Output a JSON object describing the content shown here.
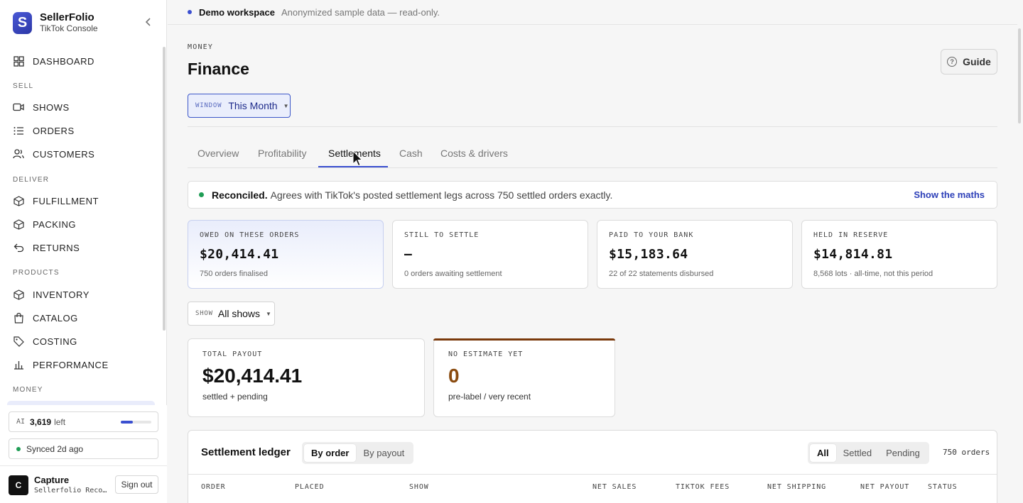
{
  "brand": {
    "name": "SellerFolio",
    "sub": "TikTok Console",
    "logo_letter": "S"
  },
  "sidebar": {
    "sections": {
      "sell": "SELL",
      "deliver": "DELIVER",
      "products": "PRODUCTS",
      "money": "MONEY"
    },
    "items": [
      {
        "label": "DASHBOARD",
        "icon": "grid-icon"
      },
      {
        "label": "SHOWS",
        "icon": "video-icon"
      },
      {
        "label": "ORDERS",
        "icon": "list-icon"
      },
      {
        "label": "CUSTOMERS",
        "icon": "users-icon"
      },
      {
        "label": "FULFILLMENT",
        "icon": "box-icon"
      },
      {
        "label": "PACKING",
        "icon": "box-icon"
      },
      {
        "label": "RETURNS",
        "icon": "return-arrow-icon"
      },
      {
        "label": "INVENTORY",
        "icon": "box-icon"
      },
      {
        "label": "CATALOG",
        "icon": "shopping-bag-icon"
      },
      {
        "label": "COSTING",
        "icon": "tag-icon"
      },
      {
        "label": "PERFORMANCE",
        "icon": "bar-chart-icon"
      }
    ],
    "ai": {
      "tag": "AI",
      "count": "3,619",
      "left": "left",
      "usage_fraction": 0.4
    },
    "sync": "Synced 2d ago",
    "user": {
      "initial": "C",
      "name": "Capture",
      "sub": "Sellerfolio Recording",
      "signout": "Sign out"
    }
  },
  "topbar": {
    "title": "Demo workspace",
    "note": "Anonymized sample data — read-only."
  },
  "header": {
    "eyebrow": "MONEY",
    "title": "Finance",
    "guide": "Guide"
  },
  "window_select": {
    "tag": "WINDOW",
    "value": "This Month"
  },
  "tabs": [
    "Overview",
    "Profitability",
    "Settlements",
    "Cash",
    "Costs & drivers"
  ],
  "active_tab": "Settlements",
  "reconcile": {
    "title": "Reconciled.",
    "text": "Agrees with TikTok's posted settlement legs across 750 settled orders exactly.",
    "link": "Show the maths"
  },
  "kpis": [
    {
      "label": "OWED ON THESE ORDERS",
      "value": "$20,414.41",
      "sub": "750 orders finalised"
    },
    {
      "label": "STILL TO SETTLE",
      "value": "—",
      "sub": "0 orders awaiting settlement"
    },
    {
      "label": "PAID TO YOUR BANK",
      "value": "$15,183.64",
      "sub": "22 of 22 statements disbursed"
    },
    {
      "label": "HELD IN RESERVE",
      "value": "$14,814.81",
      "sub": "8,568 lots · all-time, not this period"
    }
  ],
  "show_select": {
    "tag": "SHOW",
    "value": "All shows"
  },
  "payout_card": {
    "label": "TOTAL PAYOUT",
    "value": "$20,414.41",
    "sub": "settled + pending"
  },
  "estimate_card": {
    "label": "NO ESTIMATE YET",
    "value": "0",
    "sub": "pre-label / very recent",
    "accent": "#8a4b0f"
  },
  "ledger": {
    "title": "Settlement ledger",
    "view_options": [
      "By order",
      "By payout"
    ],
    "active_view": "By order",
    "filters": [
      "All",
      "Settled",
      "Pending"
    ],
    "active_filter": "All",
    "count": "750 orders",
    "columns": [
      "ORDER",
      "PLACED",
      "SHOW",
      "NET SALES",
      "TIKTOK FEES",
      "NET SHIPPING",
      "NET PAYOUT",
      "STATUS"
    ]
  },
  "colors": {
    "accent": "#3a4fd0",
    "success": "#1f9d55",
    "warning": "#8a4b0f"
  }
}
